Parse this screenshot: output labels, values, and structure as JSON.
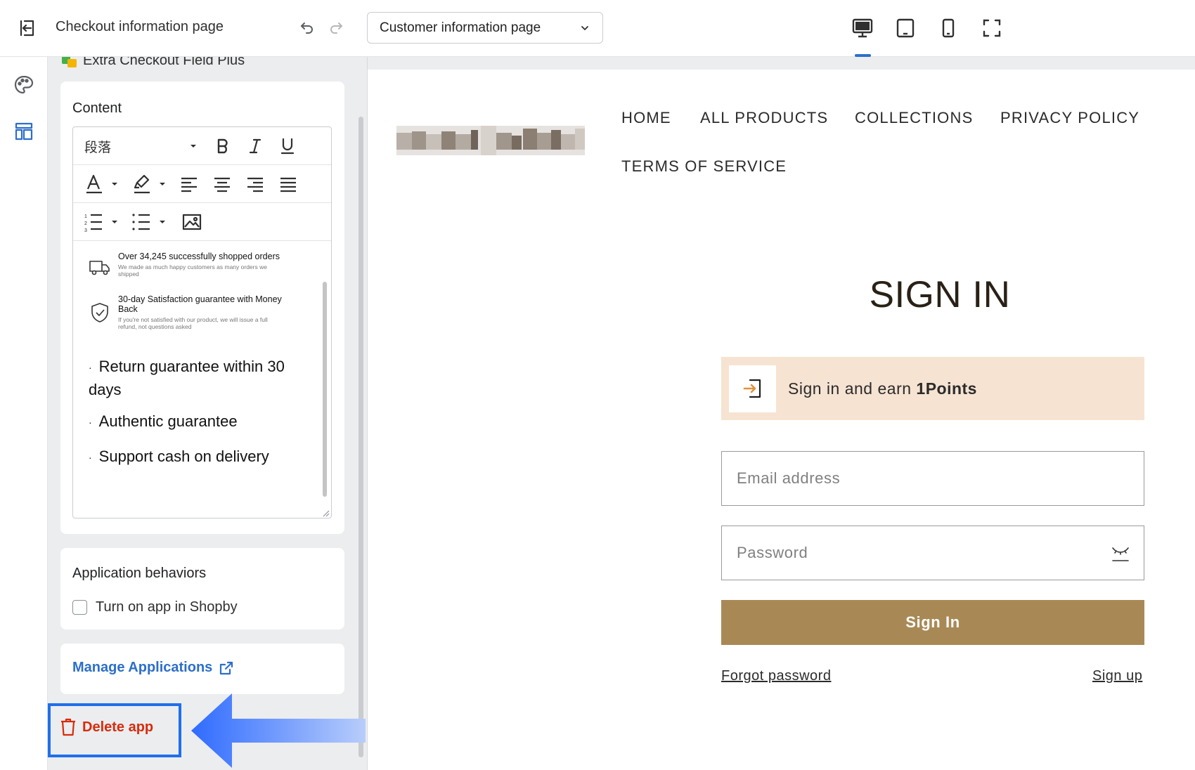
{
  "topbar": {
    "title": "Checkout information page",
    "page_select_value": "Customer information page"
  },
  "panel": {
    "app_name": "Extra Checkout Field Plus",
    "content_card": {
      "title": "Content",
      "paragraph_format": "段落",
      "features": [
        {
          "title": "Over 34,245 successfully shopped orders",
          "subtitle": "We made as much happy customers as many orders we shipped"
        },
        {
          "title": "30-day Satisfaction guarantee with Money Back",
          "subtitle": "If you're not satisfied with our product, we will issue a full refund, not questions asked"
        }
      ],
      "bullets": [
        "Return guarantee within 30 days",
        "Authentic guarantee",
        "Support cash on delivery"
      ]
    },
    "behaviors_card": {
      "title": "Application behaviors",
      "checkbox_label": "Turn on app in Shopby",
      "checked": false
    },
    "manage_link": "Manage Applications",
    "delete_label": "Delete app"
  },
  "preview": {
    "nav": [
      "HOME",
      "ALL PRODUCTS",
      "COLLECTIONS",
      "PRIVACY POLICY",
      "TERMS OF SERVICE"
    ],
    "heading": "SIGN IN",
    "points_banner_prefix": "Sign in and earn ",
    "points_banner_bold": "1Points",
    "email_placeholder": "Email address",
    "password_placeholder": "Password",
    "signin_button": "Sign In",
    "forgot_password": "Forgot password",
    "sign_up": "Sign up"
  },
  "colors": {
    "accent_blue": "#2c6ecb",
    "delete_red": "#d72c0d",
    "signin_button": "#a88956",
    "points_banner": "#f6e3d2"
  }
}
